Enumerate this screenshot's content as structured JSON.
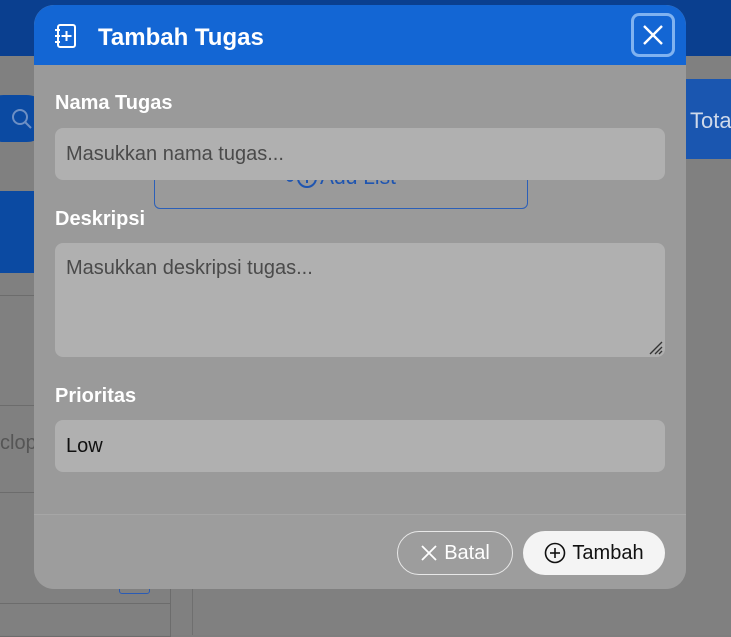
{
  "modal": {
    "title": "Tambah Tugas",
    "fields": {
      "name": {
        "label": "Nama Tugas",
        "placeholder": "Masukkan nama tugas..."
      },
      "description": {
        "label": "Deskripsi",
        "placeholder": "Masukkan deskripsi tugas..."
      },
      "priority": {
        "label": "Prioritas",
        "value": "Low"
      }
    },
    "buttons": {
      "cancel": "Batal",
      "submit": "Tambah"
    }
  },
  "background": {
    "add_list": "Add List",
    "total_label": "Tota",
    "truncated_text": "clopedia dan …"
  },
  "colors": {
    "header_blue": "#1366d4",
    "topbar_blue": "#0a3f8f",
    "overlay_gray": "#9a9a9a",
    "danger_red": "#c0392b",
    "link_blue": "#1f55b0"
  },
  "icons": {
    "header": "notebook-plus-icon",
    "close": "close-icon",
    "search": "search-icon",
    "list": "list-icon",
    "trash": "trash-icon",
    "delete": "x-icon",
    "view": "eye-icon",
    "add": "plus-circle-icon",
    "cancel": "x-icon"
  }
}
